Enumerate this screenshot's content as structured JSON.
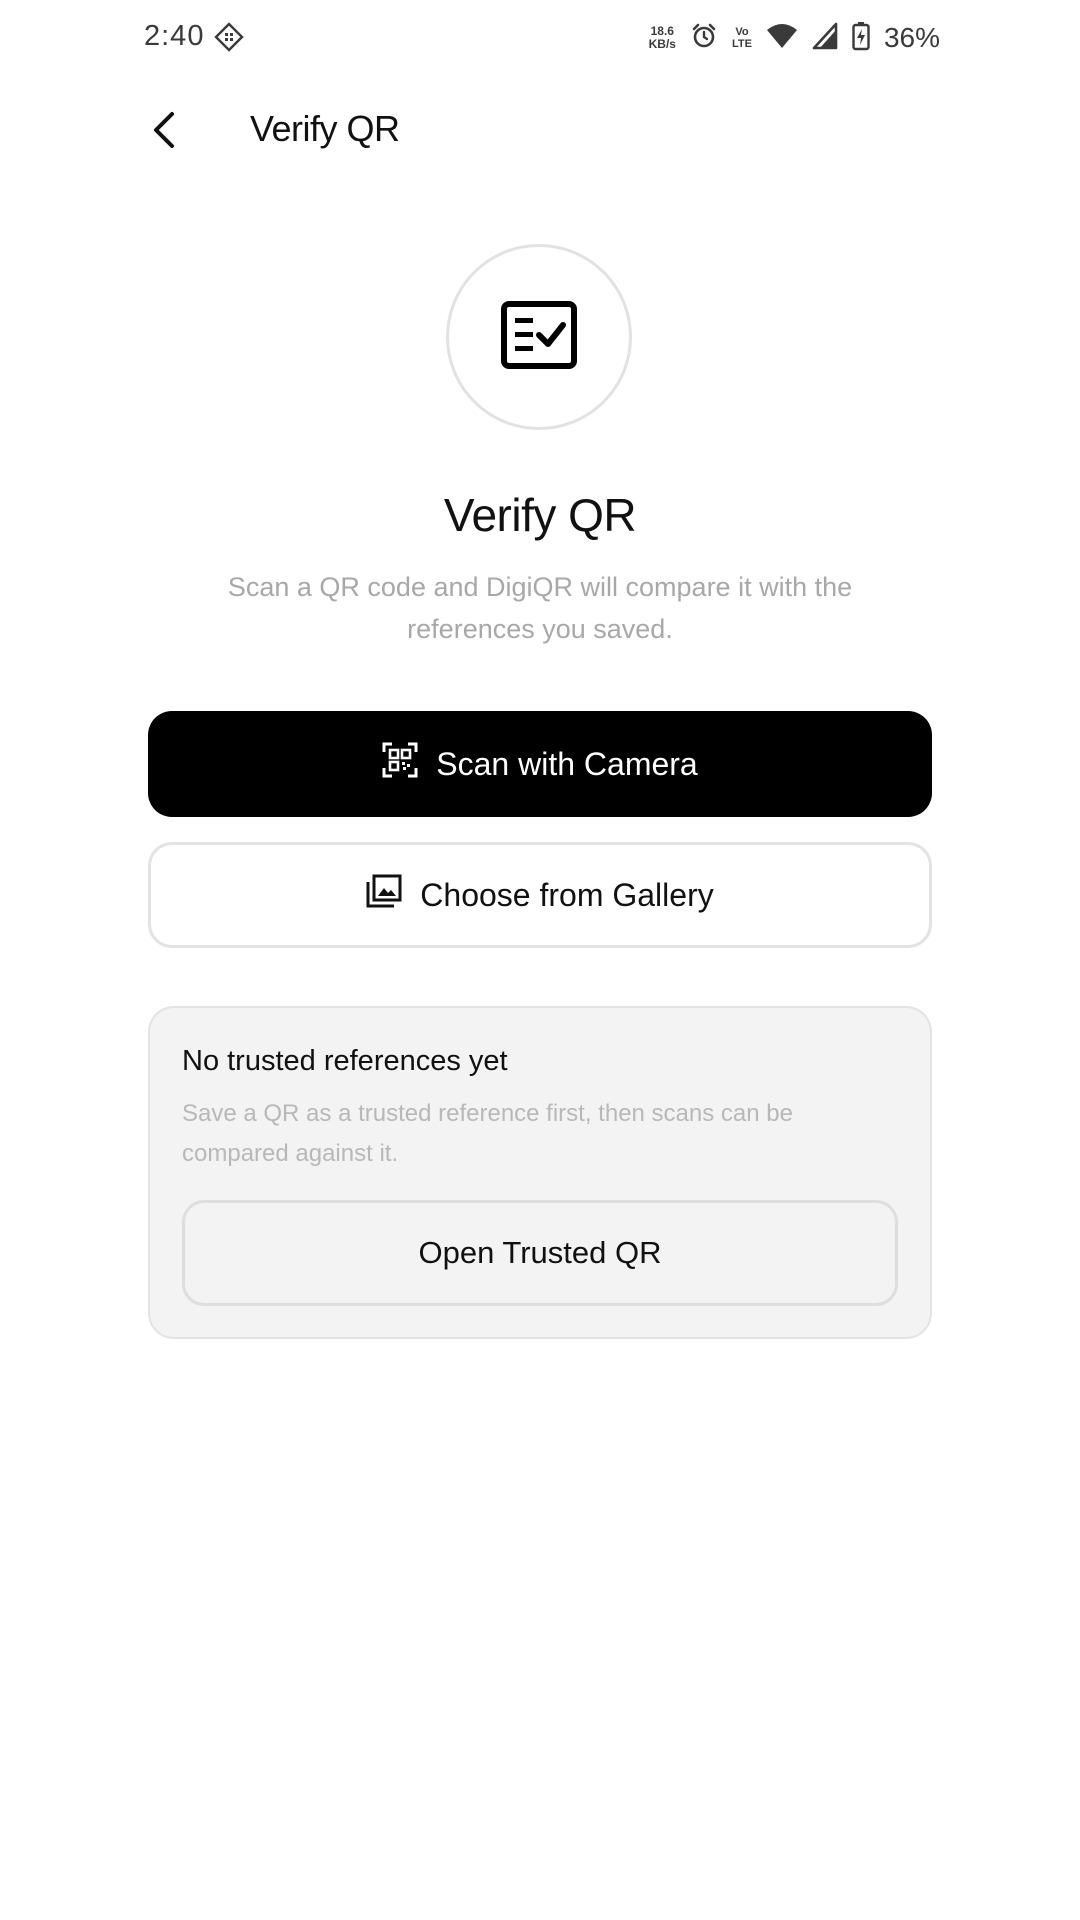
{
  "status_bar": {
    "time": "2:40",
    "network_speed_value": "18.6",
    "network_speed_unit": "KB/s",
    "volte_top": "Vo",
    "volte_bottom": "LTE",
    "battery_percent": "36%"
  },
  "header": {
    "title": "Verify QR"
  },
  "hero": {
    "icon": "checklist-icon",
    "title": "Verify QR",
    "subtitle": "Scan a QR code and DigiQR will compare it with the references you saved."
  },
  "actions": {
    "scan_camera_label": "Scan with Camera",
    "choose_gallery_label": "Choose from Gallery"
  },
  "trusted_card": {
    "title": "No trusted references yet",
    "description": "Save a QR as a trusted reference first, then scans can be compared against it.",
    "button_label": "Open Trusted QR"
  },
  "colors": {
    "primary_button": "#000000",
    "subtle_text": "#a8a8a8",
    "card_background": "#f3f3f3"
  }
}
